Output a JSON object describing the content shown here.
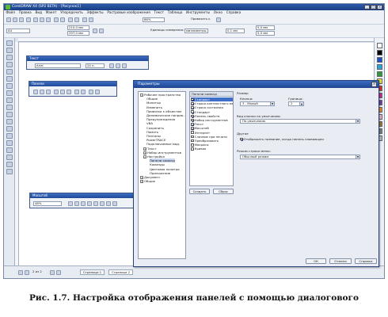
{
  "window": {
    "title": "CorelDRAW X4 (SP2 BETA) - [Рисунок1]",
    "controls": [
      "_",
      "□",
      "×"
    ]
  },
  "menu": [
    "Файл",
    "Правка",
    "Вид",
    "Макет",
    "Упорядочить",
    "Эффекты",
    "Растровые изображения",
    "Текст",
    "Таблица",
    "Инструменты",
    "Окно",
    "Справка"
  ],
  "standard_toolbar": {
    "zoom": "86%",
    "snap_label": "Привязать к"
  },
  "property_bar": {
    "paper": "A4",
    "width": "210,0 мм",
    "height": "297,0 мм",
    "units_label": "Единицы измерения:",
    "units": "миллиметры",
    "nudge": "0,1 мм",
    "dup_x": "5,0 мм",
    "dup_y": "5,0 мм"
  },
  "floating": {
    "text_toolbar": {
      "title": "Текст",
      "font": "Arial",
      "size": "24 п."
    },
    "align_toolbar": {
      "title": "Панели"
    },
    "zoom_toolbar": {
      "title": "Масштаб",
      "zoom": "48%"
    }
  },
  "status": {
    "page_counter": "2 из 2",
    "tab1": "Страница 1",
    "tab2": "Страница 2"
  },
  "dialog": {
    "title": "Параметры",
    "tree": [
      {
        "label": "Рабочее пространство",
        "level": 0,
        "sign": "−"
      },
      {
        "label": "Общие",
        "level": 2
      },
      {
        "label": "Монитор",
        "level": 2
      },
      {
        "label": "Изменить",
        "level": 2
      },
      {
        "label": "Привязка к объектам",
        "level": 2
      },
      {
        "label": "Динамические направ...",
        "level": 2
      },
      {
        "label": "Предупреждения",
        "level": 2
      },
      {
        "label": "VBA",
        "level": 2
      },
      {
        "label": "Сохранить",
        "level": 2
      },
      {
        "label": "Память",
        "level": 2
      },
      {
        "label": "Плагины",
        "level": 2
      },
      {
        "label": "PowerTRACE",
        "level": 2
      },
      {
        "label": "Подключаемые мод.",
        "level": 2
      },
      {
        "label": "Текст",
        "level": 1,
        "sign": "+"
      },
      {
        "label": "Набор инструментов",
        "level": 1,
        "sign": "+"
      },
      {
        "label": "Настройка",
        "level": 1,
        "sign": "−"
      },
      {
        "label": "Панели команд",
        "level": 3,
        "selected": true
      },
      {
        "label": "Команды",
        "level": 3
      },
      {
        "label": "Цветовая палитра",
        "level": 3
      },
      {
        "label": "Приложение",
        "level": 3
      },
      {
        "label": "Документ",
        "level": 0,
        "sign": "+"
      },
      {
        "label": "Общие",
        "level": 0,
        "sign": "+"
      }
    ],
    "list_header": "Панели команд",
    "list_items": [
      {
        "label": "Стандарт",
        "checked": true,
        "selected": true
      },
      {
        "label": "Строка контекстного ме...",
        "checked": true
      },
      {
        "label": "Строка состояния",
        "checked": true
      },
      {
        "label": "Стандарт",
        "checked": true
      },
      {
        "label": "Панель свойств",
        "checked": true
      },
      {
        "label": "Набор инструментов",
        "checked": true
      },
      {
        "label": "Текст",
        "checked": true
      },
      {
        "label": "Масштаб",
        "checked": true
      },
      {
        "label": "Интернет",
        "checked": false
      },
      {
        "label": "Слияние при печати",
        "checked": false
      },
      {
        "label": "Преобразовать",
        "checked": false
      },
      {
        "label": "Макросы",
        "checked": false
      },
      {
        "label": "Кривая",
        "checked": false
      }
    ],
    "buttons": {
      "new": "Создать",
      "delete": "Сброс",
      "ok": "ОК",
      "cancel": "Отмена",
      "help": "Справка"
    },
    "size_group": "Размер",
    "buttons_label": "Кнопки:",
    "buttons_value": "3 - Малый",
    "border_label": "Граница:",
    "border_value": "2",
    "default_button_label": "Вид кнопки по умолчанию:",
    "default_button_value": "По умолчанию",
    "other_label": "Другое",
    "lock_label": "Отображать название, когда панель плавающая",
    "lock_checked": true,
    "menu_mode_label": "Режим строки меню:",
    "menu_mode_value": "Обычный режим"
  },
  "caption": "Рис. 1.7. Настройка отображения панелей с помощью диалогового"
}
